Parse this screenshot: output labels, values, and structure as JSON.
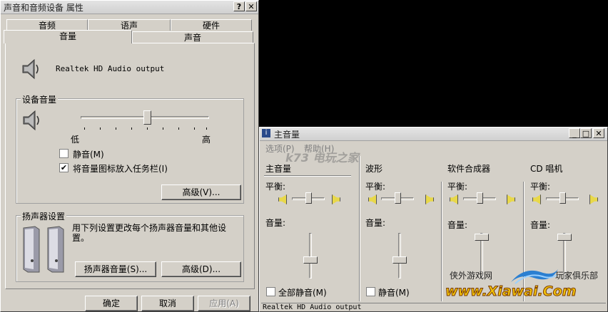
{
  "props": {
    "title": "声音和音频设备 属性",
    "help_btn": "?",
    "close_btn": "✕",
    "tabs_row1": [
      "音频",
      "语声",
      "硬件"
    ],
    "tabs_row2": [
      "音量",
      "声音"
    ],
    "device_name": "Realtek HD Audio output",
    "device_volume": {
      "label": "设备音量",
      "low": "低",
      "high": "高",
      "level": 0.52,
      "mute_label": "静音(M)",
      "mute_checked": false,
      "mute_mark": "",
      "tray_label": "将音量图标放入任务栏(I)",
      "tray_checked": true,
      "tray_mark": "✔",
      "advanced_btn": "高级(V)..."
    },
    "speaker_settings": {
      "label": "扬声器设置",
      "desc": "用下列设置更改每个扬声器音量和其他设置。",
      "speaker_volume_btn": "扬声器音量(S)...",
      "advanced_btn": "高级(D)..."
    },
    "ok_btn": "确定",
    "cancel_btn": "取消",
    "apply_btn": "应用(A)"
  },
  "mixer": {
    "title": "主音量",
    "min_btn": "_",
    "max_btn": "□",
    "close_btn": "✕",
    "menu": [
      "选项(P)",
      "帮助(H)"
    ],
    "balance_label": "平衡:",
    "volume_label": "音量:",
    "channels": [
      {
        "name": "主音量",
        "balance": 0.5,
        "volume": 0.4,
        "mute_label": "全部静音(M)",
        "mute_checked": false,
        "mute_mark": ""
      },
      {
        "name": "波形",
        "balance": 0.5,
        "volume": 0.4,
        "mute_label": "静音(M)",
        "mute_checked": false,
        "mute_mark": ""
      },
      {
        "name": "软件合成器",
        "balance": 0.5,
        "volume": 0.9
      },
      {
        "name": "CD 唱机",
        "balance": 0.5,
        "volume": 0.9
      }
    ],
    "status": "Realtek HD Audio output"
  },
  "watermarks": {
    "k73": "k73 电玩之家",
    "xiawai_cn": "侠外游戏网",
    "xiawai_club": "玩家俱乐部",
    "xiawai_url": "www.Xiawai.Com"
  }
}
